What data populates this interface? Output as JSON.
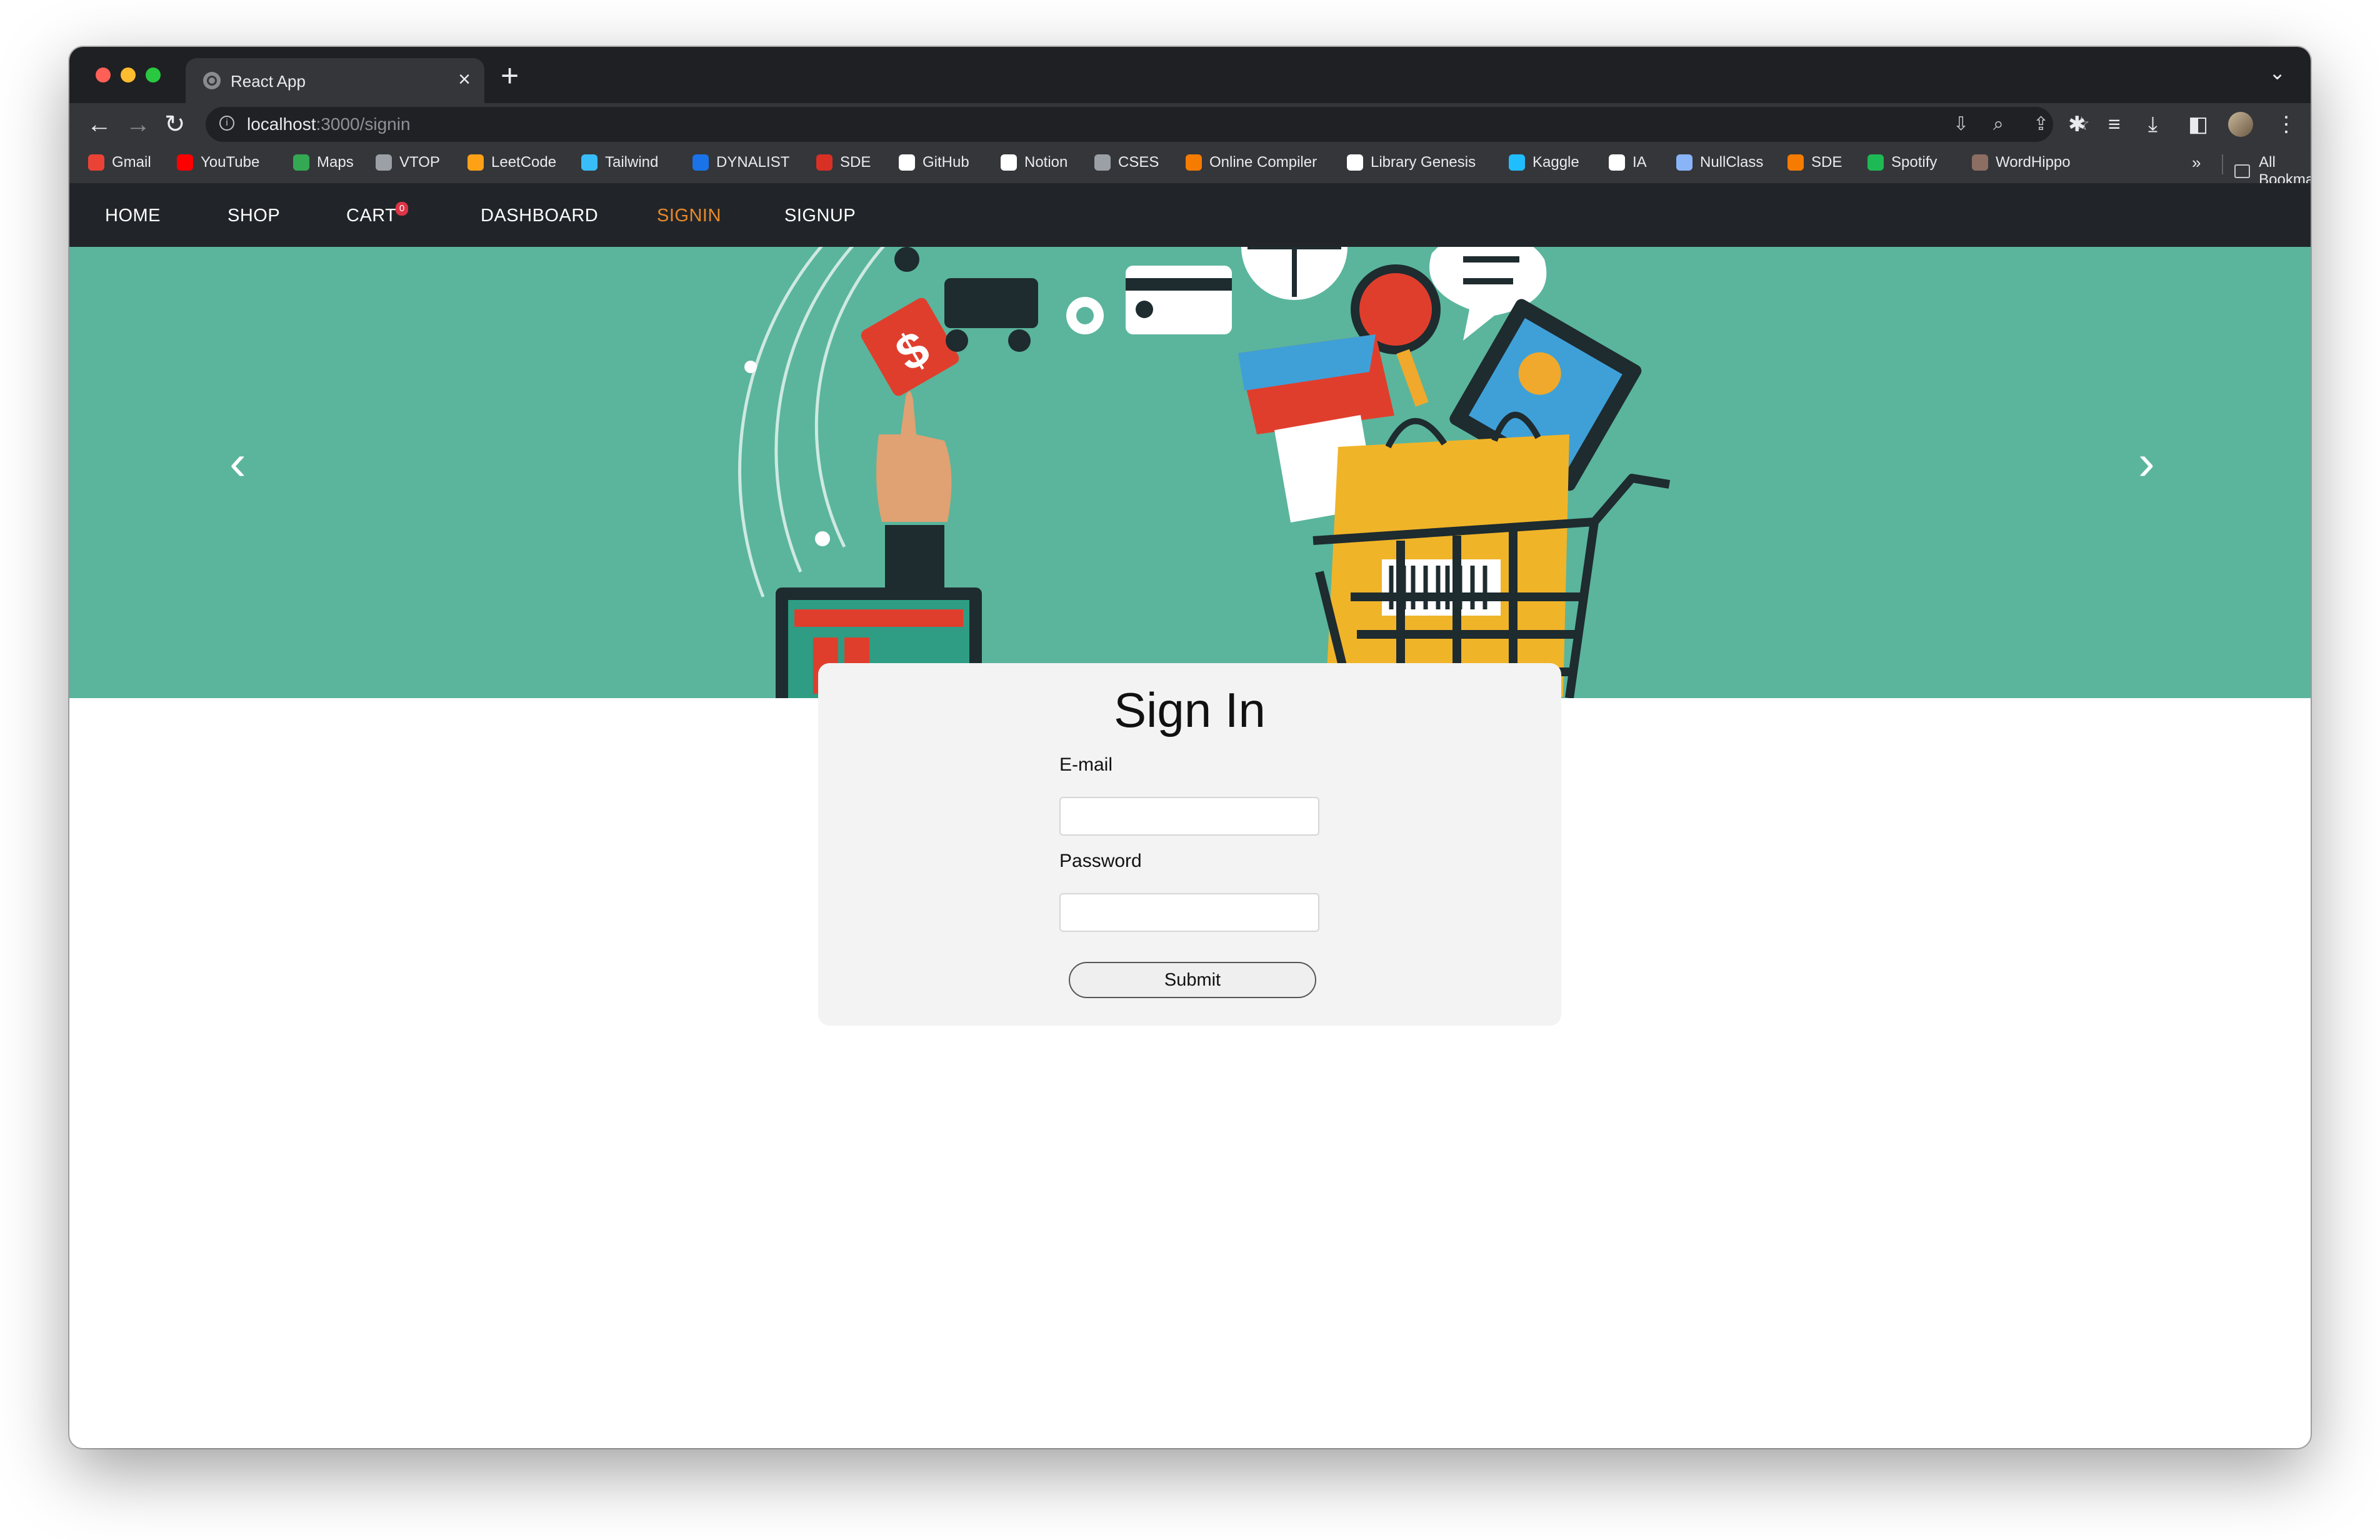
{
  "browser": {
    "tab_title": "React App",
    "tab_close": "×",
    "new_tab": "+",
    "url_host": "localhost",
    "url_path": ":3000/signin",
    "bookmarks": [
      {
        "label": "Gmail",
        "icon": "gmail-icon",
        "color": "#ea4335"
      },
      {
        "label": "YouTube",
        "icon": "youtube-icon",
        "color": "#ff0000"
      },
      {
        "label": "Maps",
        "icon": "maps-icon",
        "color": "#34a853"
      },
      {
        "label": "VTOP",
        "icon": "vtop-icon",
        "color": "#9aa0a6"
      },
      {
        "label": "LeetCode",
        "icon": "leetcode-icon",
        "color": "#ffa116"
      },
      {
        "label": "Tailwind",
        "icon": "tailwind-icon",
        "color": "#38bdf8"
      },
      {
        "label": "DYNALIST",
        "icon": "dynalist-icon",
        "color": "#1a73e8"
      },
      {
        "label": "SDE",
        "icon": "sde-icon",
        "color": "#d93025"
      },
      {
        "label": "GitHub",
        "icon": "github-icon",
        "color": "#ffffff"
      },
      {
        "label": "Notion",
        "icon": "notion-icon",
        "color": "#ffffff"
      },
      {
        "label": "CSES",
        "icon": "cses-icon",
        "color": "#9aa0a6"
      },
      {
        "label": "Online Compiler",
        "icon": "compiler-icon",
        "color": "#f57c00"
      },
      {
        "label": "Library Genesis",
        "icon": "libgen-icon",
        "color": "#ffffff"
      },
      {
        "label": "Kaggle",
        "icon": "kaggle-icon",
        "color": "#20beff"
      },
      {
        "label": "IA",
        "icon": "internet-archive-icon",
        "color": "#ffffff"
      },
      {
        "label": "NullClass",
        "icon": "nullclass-icon",
        "color": "#8ab4f8"
      },
      {
        "label": "SDE",
        "icon": "sde-icon-2",
        "color": "#f57c00"
      },
      {
        "label": "Spotify",
        "icon": "spotify-icon",
        "color": "#1db954"
      },
      {
        "label": "WordHippo",
        "icon": "wordhippo-icon",
        "color": "#8d6e63"
      }
    ],
    "bookmarks_more": "»",
    "all_bookmarks": "All Bookmarks"
  },
  "navbar": {
    "items": [
      "HOME",
      "SHOP",
      "CART",
      "DASHBOARD",
      "SIGNIN",
      "SIGNUP"
    ],
    "active": "SIGNIN",
    "cart_count": "0",
    "active_color": "#e8892a"
  },
  "carousel": {
    "prev": "‹",
    "next": "›",
    "background": "#5ab59c"
  },
  "signin": {
    "title": "Sign In",
    "email_label": "E-mail",
    "email_value": "",
    "password_label": "Password",
    "password_value": "",
    "submit_label": "Submit"
  }
}
